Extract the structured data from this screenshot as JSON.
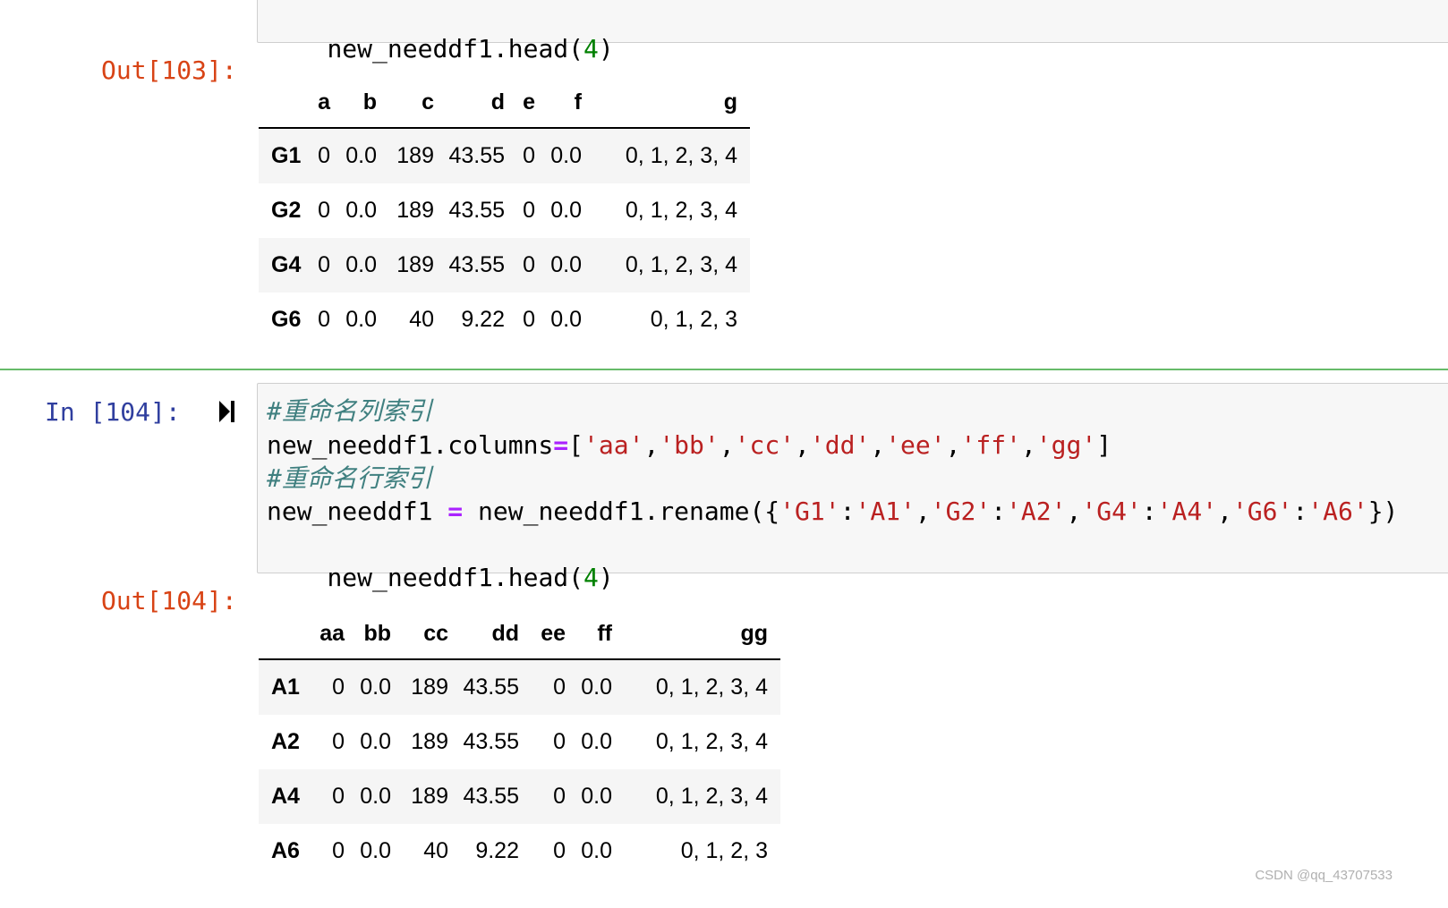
{
  "cell103": {
    "input_last_line": "new_needdf1.head(4)",
    "out_prompt": "Out[103]:",
    "table": {
      "columns": [
        "a",
        "b",
        "c",
        "d",
        "e",
        "f",
        "g"
      ],
      "rows": [
        {
          "index": "G1",
          "values": [
            "0",
            "0.0",
            "189",
            "43.55",
            "0",
            "0.0",
            "0, 1,  2,  3,  4"
          ]
        },
        {
          "index": "G2",
          "values": [
            "0",
            "0.0",
            "189",
            "43.55",
            "0",
            "0.0",
            "0, 1,  2,  3,  4"
          ]
        },
        {
          "index": "G4",
          "values": [
            "0",
            "0.0",
            "189",
            "43.55",
            "0",
            "0.0",
            "0, 1,  2,  3,  4"
          ]
        },
        {
          "index": "G6",
          "values": [
            "0",
            "0.0",
            "40",
            "9.22",
            "0",
            "0.0",
            "0, 1,  2,  3"
          ]
        }
      ]
    }
  },
  "cell104": {
    "in_prompt": "In [104]:",
    "code": {
      "comment1": "#重命名列索引",
      "line2_prefix": "new_needdf1.columns",
      "line2_eq": "=",
      "line2_open": "[",
      "line2_strs": [
        "'aa'",
        "'bb'",
        "'cc'",
        "'dd'",
        "'ee'",
        "'ff'",
        "'gg'"
      ],
      "line2_close": "]",
      "comment3": "#重命名行索引",
      "line4_prefix": "new_needdf1 ",
      "line4_eq": "=",
      "line4_mid": " new_needdf1.rename({",
      "line4_pairs": [
        [
          "'G1'",
          "'A1'"
        ],
        [
          "'G2'",
          "'A2'"
        ],
        [
          "'G4'",
          "'A4'"
        ],
        [
          "'G6'",
          "'A6'"
        ]
      ],
      "line4_close": "})",
      "line5_prefix": "new_needdf1.head(",
      "line5_num": "4",
      "line5_close": ")"
    },
    "out_prompt": "Out[104]:",
    "table": {
      "columns": [
        "aa",
        "bb",
        "cc",
        "dd",
        "ee",
        "ff",
        "gg"
      ],
      "rows": [
        {
          "index": "A1",
          "values": [
            "0",
            "0.0",
            "189",
            "43.55",
            "0",
            "0.0",
            "0, 1,  2,  3,  4"
          ]
        },
        {
          "index": "A2",
          "values": [
            "0",
            "0.0",
            "189",
            "43.55",
            "0",
            "0.0",
            "0, 1,  2,  3,  4"
          ]
        },
        {
          "index": "A4",
          "values": [
            "0",
            "0.0",
            "189",
            "43.55",
            "0",
            "0.0",
            "0, 1,  2,  3,  4"
          ]
        },
        {
          "index": "A6",
          "values": [
            "0",
            "0.0",
            "40",
            "9.22",
            "0",
            "0.0",
            "0, 1,  2,  3"
          ]
        }
      ]
    }
  },
  "watermark": "CSDN @qq_43707533",
  "icons": {
    "run": "run-cell-icon"
  }
}
